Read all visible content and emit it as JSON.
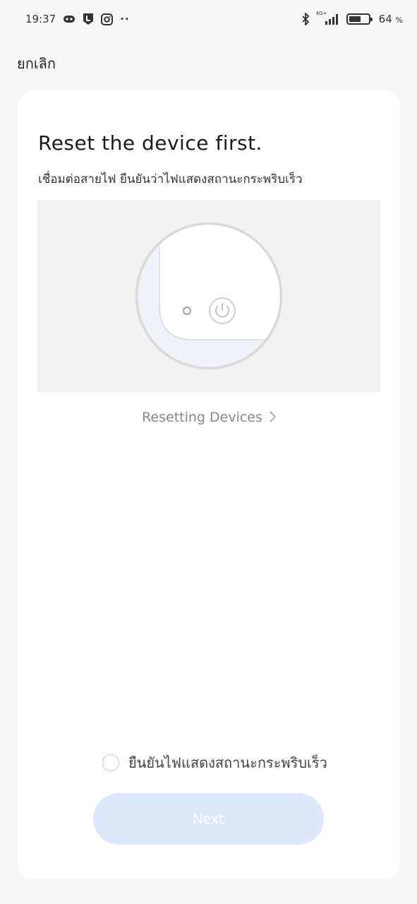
{
  "status_bar": {
    "time": "19:37",
    "more": "··",
    "network": "4G+",
    "battery_text": "64",
    "battery_unit": "%",
    "battery_level": 0.64,
    "icons": [
      "game-controller-icon",
      "l-app-icon",
      "instagram-icon",
      "bluetooth-icon",
      "signal-icon",
      "battery-icon"
    ]
  },
  "header": {
    "cancel_label": "ยกเลิก"
  },
  "card": {
    "title": "Reset the device first.",
    "subtitle": "เชื่อมต่อสายไฟ ยืนยันว่าไฟแสดงสถานะกระพริบเร็ว",
    "illustration_icons": [
      "indicator-light-icon",
      "power-button-icon"
    ],
    "reset_link_label": "Resetting Devices",
    "confirm_label": "ยืนยันไฟแสดงสถานะกระพริบเร็ว",
    "confirm_checked": false,
    "next_label": "Next"
  },
  "colors": {
    "background": "#f7f7f7",
    "card": "#ffffff",
    "illustration_bg": "#f1f1f1",
    "button_disabled": "#dde8fa",
    "link_text": "#888888"
  }
}
